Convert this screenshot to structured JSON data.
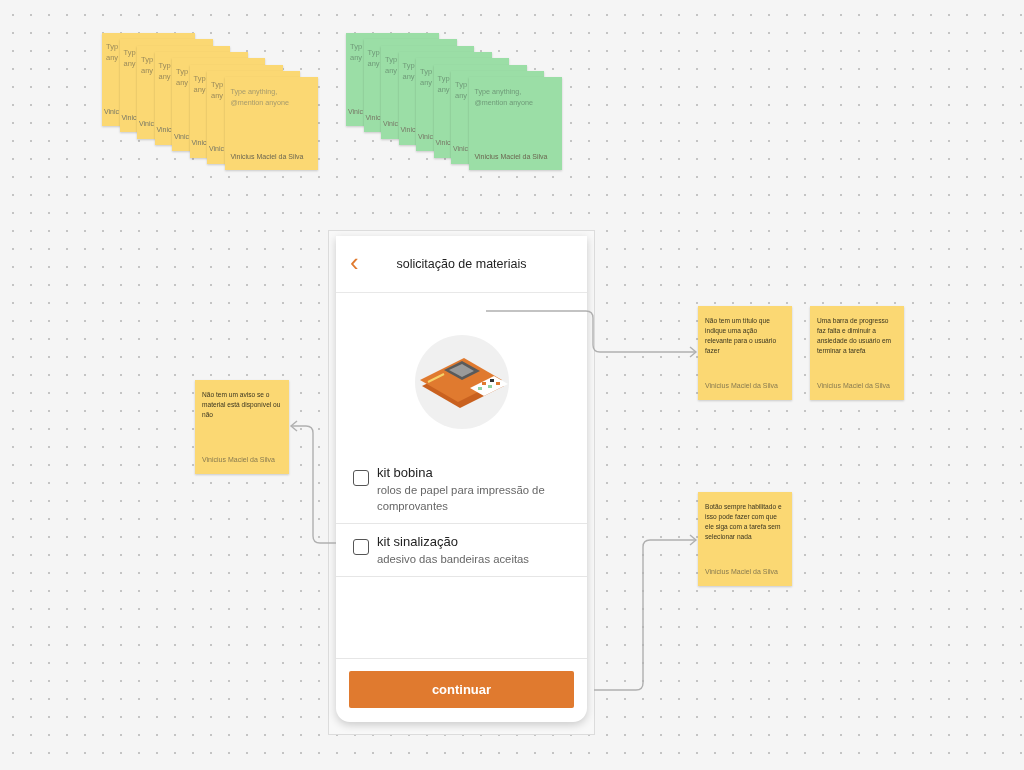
{
  "sticky_stacks": [
    {
      "color": "#fbd873",
      "back_notes": [
        {
          "lines": [
            "Typ",
            "any"
          ],
          "author": "Vinic"
        },
        {
          "lines": [
            "Typ",
            "any"
          ],
          "author": "Vinic"
        },
        {
          "lines": [
            "Typ",
            "any"
          ],
          "author": "Vinic"
        },
        {
          "lines": [
            "Typ",
            "any"
          ],
          "author": "Vinic"
        },
        {
          "lines": [
            "Typ",
            "any"
          ],
          "author": "Vinic"
        },
        {
          "lines": [
            "Typ",
            "any"
          ],
          "author": "Vinic"
        },
        {
          "lines": [
            "Typ",
            "any"
          ],
          "author": "Vinic"
        }
      ],
      "front_note": {
        "text": "Type anything, @mention anyone",
        "author": "Vinicius Maciel da Silva"
      }
    },
    {
      "color": "#9bdea6",
      "back_notes": [
        {
          "lines": [
            "Typ",
            "any"
          ],
          "author": "Vinic"
        },
        {
          "lines": [
            "Typ",
            "any"
          ],
          "author": "Vinic"
        },
        {
          "lines": [
            "Typ",
            "any"
          ],
          "author": "Vinic"
        },
        {
          "lines": [
            "Typ",
            "any"
          ],
          "author": "Vinic"
        },
        {
          "lines": [
            "Typ",
            "any"
          ],
          "author": "Vinic"
        },
        {
          "lines": [
            "Typ",
            "any"
          ],
          "author": "Vinic"
        },
        {
          "lines": [
            "Typ",
            "any"
          ],
          "author": "Vinic"
        }
      ],
      "front_note": {
        "text": "Type anything, @mention anyone",
        "author": "Vinicius Maciel da Silva"
      }
    }
  ],
  "phone_screen": {
    "back_icon": "‹",
    "title": "solicitação de materiais",
    "items": [
      {
        "title": "kit bobina",
        "description": "rolos de papel para impressão de comprovantes",
        "checked": false
      },
      {
        "title": "kit sinalização",
        "description": "adesivo das bandeiras aceitas",
        "checked": false
      }
    ],
    "button": "continuar"
  },
  "comment_notes": [
    {
      "text": "Não tem um título que indique uma ação relevante para o usuário fazer",
      "author": "Vinicius Maciel da Silva"
    },
    {
      "text": "Uma barra de progresso faz falta e diminuir a ansiedade do usuário em terminar a tarefa",
      "author": "Vinicius Maciel da Silva"
    },
    {
      "text": "Não tem um aviso se o material está disponível ou não",
      "author": "Vinicius Maciel da Silva"
    },
    {
      "text": "Botão sempre habilitado e isso pode fazer com que ele siga com a tarefa sem selecionar nada",
      "author": "Vinicius Maciel da Silva"
    }
  ]
}
